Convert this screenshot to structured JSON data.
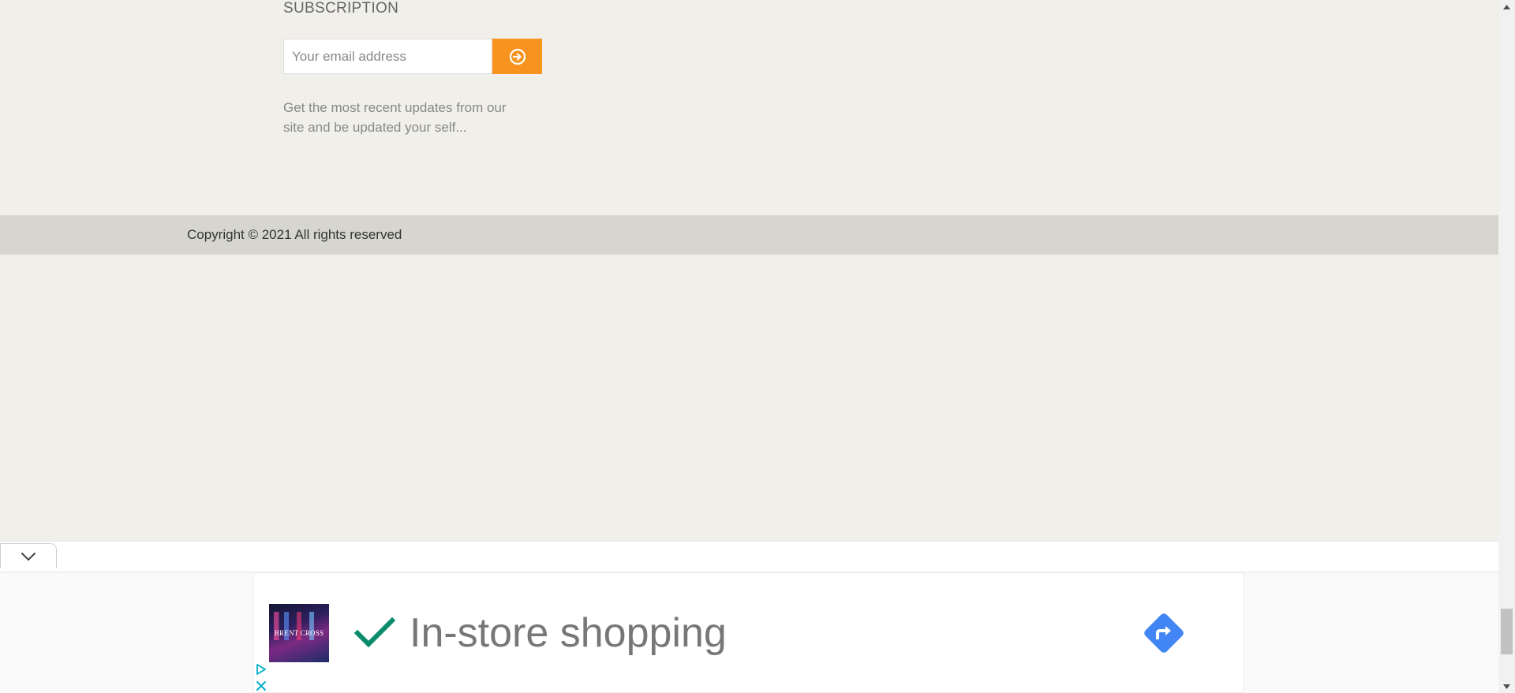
{
  "subscription": {
    "heading": "SUBSCRIPTION",
    "email_placeholder": "Your email address",
    "submit_icon": "circle-arrow-right-icon",
    "description": "Get the most recent updates from our site and be updated your self..."
  },
  "footer": {
    "copyright": "Copyright © 2021 All rights reserved"
  },
  "ad": {
    "collapse_icon": "chevron-down-icon",
    "thumbnail_text": "BRENT CROSS",
    "check_icon": "checkmark-icon",
    "headline": "In-store shopping",
    "directions_icon": "directions-icon",
    "adchoices_icon": "adchoices-icon",
    "close_icon": "close-icon"
  },
  "colors": {
    "page_bg": "#f0efe9",
    "copyright_bg": "#d6d6cf",
    "accent_orange": "#f7931e",
    "check_green": "#0d8c6b",
    "directions_blue": "#4285f4",
    "adchoices_teal": "#00aecd"
  }
}
